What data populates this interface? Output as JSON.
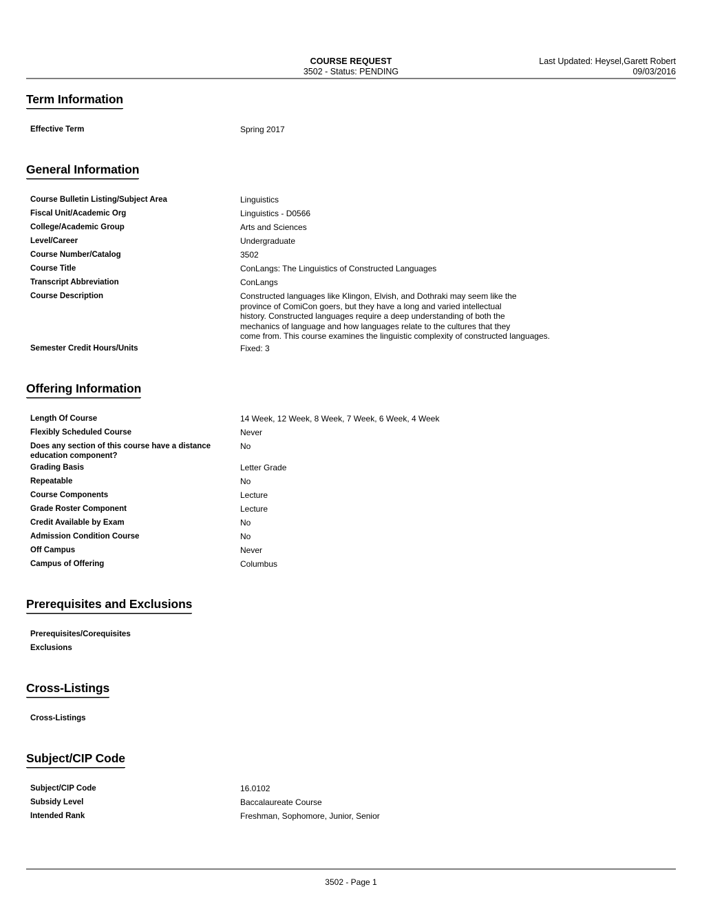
{
  "header": {
    "title": "COURSE REQUEST",
    "subtitle": "3502 - Status: PENDING",
    "last_updated": "Last Updated: Heysel,Garett Robert",
    "date": "09/03/2016"
  },
  "sections": {
    "term": {
      "heading": "Term Information",
      "rows": [
        {
          "label": "Effective Term",
          "value": "Spring 2017"
        }
      ]
    },
    "general": {
      "heading": "General Information",
      "rows": [
        {
          "label": "Course Bulletin Listing/Subject Area",
          "value": "Linguistics"
        },
        {
          "label": "Fiscal Unit/Academic Org",
          "value": "Linguistics - D0566"
        },
        {
          "label": "College/Academic Group",
          "value": "Arts and Sciences"
        },
        {
          "label": "Level/Career",
          "value": "Undergraduate"
        },
        {
          "label": "Course Number/Catalog",
          "value": "3502"
        },
        {
          "label": "Course Title",
          "value": "ConLangs: The Linguistics of Constructed Languages"
        },
        {
          "label": "Transcript Abbreviation",
          "value": "ConLangs"
        },
        {
          "label": "Course Description",
          "value": "Constructed languages like Klingon, Elvish, and Dothraki may seem like the\nprovince of ComiCon goers, but they have a long and varied intellectual\nhistory. Constructed languages require a deep understanding of both the\nmechanics of language and how languages relate to the cultures that they\ncome from. This course examines the linguistic complexity of constructed languages."
        },
        {
          "label": "Semester Credit Hours/Units",
          "value": "Fixed: 3"
        }
      ]
    },
    "offering": {
      "heading": "Offering Information",
      "rows": [
        {
          "label": "Length Of Course",
          "value": "14 Week, 12 Week, 8 Week, 7 Week, 6 Week, 4 Week"
        },
        {
          "label": "Flexibly Scheduled Course",
          "value": "Never"
        },
        {
          "label": "Does any section of this course have a distance education component?",
          "value": "No"
        },
        {
          "label": "Grading Basis",
          "value": "Letter Grade"
        },
        {
          "label": "Repeatable",
          "value": "No"
        },
        {
          "label": "Course Components",
          "value": "Lecture"
        },
        {
          "label": "Grade Roster Component",
          "value": "Lecture"
        },
        {
          "label": "Credit Available by Exam",
          "value": "No"
        },
        {
          "label": "Admission Condition Course",
          "value": "No"
        },
        {
          "label": "Off Campus",
          "value": "Never"
        },
        {
          "label": "Campus of Offering",
          "value": "Columbus"
        }
      ]
    },
    "prerequisites": {
      "heading": "Prerequisites and Exclusions",
      "rows": [
        {
          "label": "Prerequisites/Corequisites",
          "value": ""
        },
        {
          "label": "Exclusions",
          "value": ""
        }
      ]
    },
    "cross_listings": {
      "heading": "Cross-Listings",
      "rows": [
        {
          "label": "Cross-Listings",
          "value": ""
        }
      ]
    },
    "subject_cip": {
      "heading": "Subject/CIP Code",
      "rows": [
        {
          "label": "Subject/CIP Code",
          "value": "16.0102"
        },
        {
          "label": "Subsidy Level",
          "value": "Baccalaureate Course"
        },
        {
          "label": "Intended Rank",
          "value": "Freshman, Sophomore, Junior, Senior"
        }
      ]
    }
  },
  "footer": {
    "page_label": "3502 - Page 1"
  }
}
